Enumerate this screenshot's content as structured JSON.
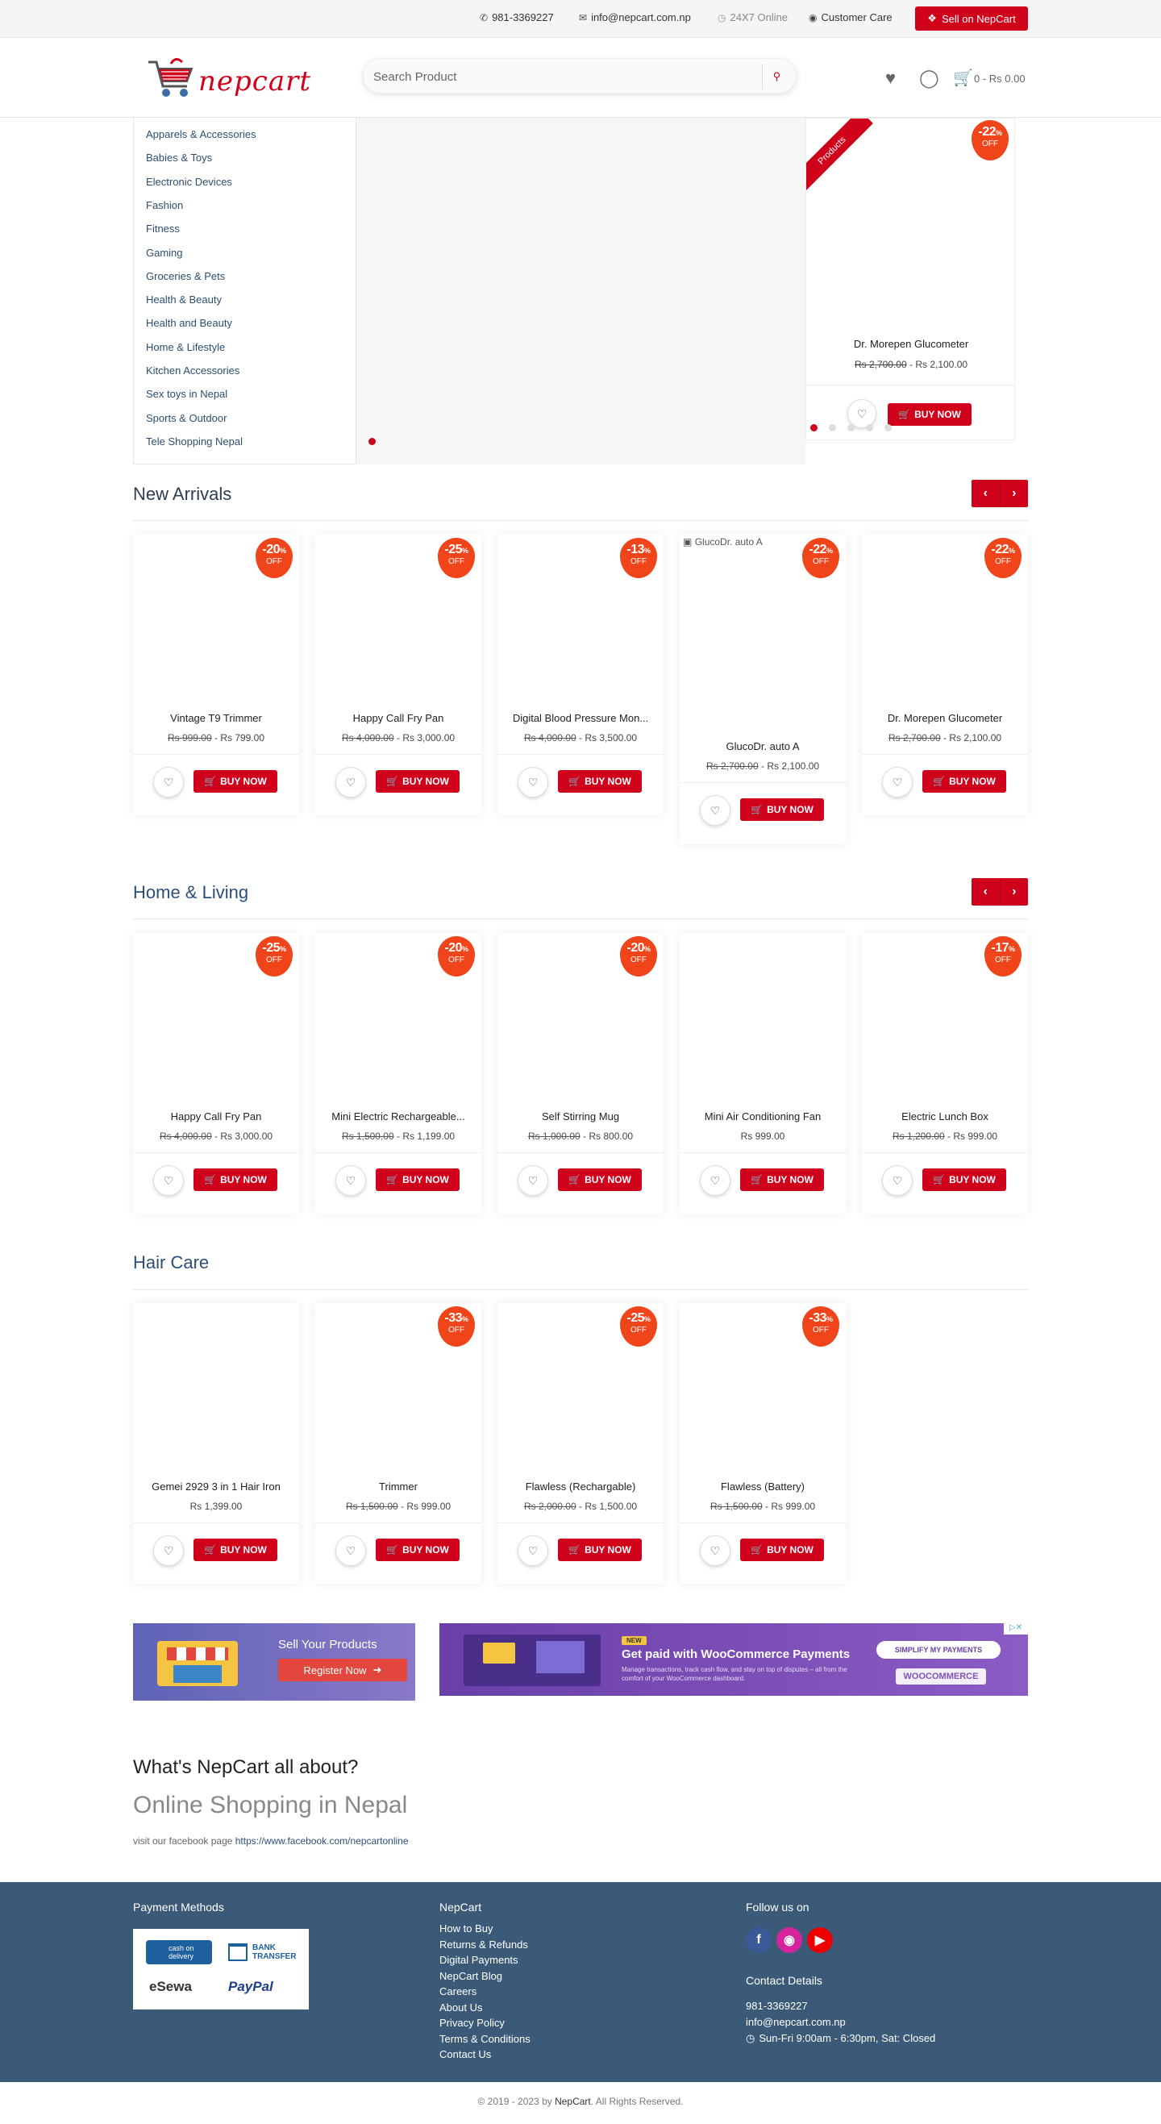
{
  "topbar": {
    "phone": "981-3369227",
    "email": "info@nepcart.com.np",
    "hours": "24X7 Online",
    "care": "Customer Care",
    "sell": "Sell on NepCart"
  },
  "header": {
    "logo_text": "nepcart",
    "search_placeholder": "Search Product",
    "cart_summary": "0 - Rs 0.00"
  },
  "categories": [
    "Apparels & Accessories",
    "Babies & Toys",
    "Electronic Devices",
    "Fashion",
    "Fitness",
    "Gaming",
    "Groceries & Pets",
    "Health & Beauty",
    "Health and Beauty",
    "Home & Lifestyle",
    "Kitchen Accessories",
    "Sex toys in Nepal",
    "Sports & Outdoor",
    "Tele Shopping Nepal"
  ],
  "featured": {
    "ribbon": "Products",
    "badge": "-22",
    "badge_off": "OFF",
    "name": "Dr. Morepen Glucometer",
    "old_price": "Rs 2,700.00",
    "price": "Rs 2,100.00",
    "buy": "BUY NOW"
  },
  "sections": {
    "new_arrivals": {
      "title": "New Arrivals",
      "products": [
        {
          "name": "Vintage T9 Trimmer",
          "old": "Rs 999.00",
          "price": "Rs 799.00",
          "badge": "-20"
        },
        {
          "name": "Happy Call Fry Pan",
          "old": "Rs 4,000.00",
          "price": "Rs 3,000.00",
          "badge": "-25"
        },
        {
          "name": "Digital Blood Pressure Mon...",
          "old": "Rs 4,000.00",
          "price": "Rs 3,500.00",
          "badge": "-13"
        },
        {
          "name": "GlucoDr. auto A",
          "old": "Rs 2,700.00",
          "price": "Rs 2,100.00",
          "badge": "-22",
          "img_alt": "GlucoDr. auto A"
        },
        {
          "name": "Dr. Morepen Glucometer",
          "old": "Rs 2,700.00",
          "price": "Rs 2,100.00",
          "badge": "-22"
        }
      ]
    },
    "home_living": {
      "title": "Home & Living",
      "products": [
        {
          "name": "Happy Call Fry Pan",
          "old": "Rs 4,000.00",
          "price": "Rs 3,000.00",
          "badge": "-25"
        },
        {
          "name": "Mini Electric Rechargeable...",
          "old": "Rs 1,500.00",
          "price": "Rs 1,199.00",
          "badge": "-20"
        },
        {
          "name": "Self Stirring Mug",
          "old": "Rs 1,000.00",
          "price": "Rs 800.00",
          "badge": "-20"
        },
        {
          "name": "Mini Air Conditioning Fan",
          "old": "",
          "price": "Rs 999.00",
          "badge": ""
        },
        {
          "name": "Electric Lunch Box",
          "old": "Rs 1,200.00",
          "price": "Rs 999.00",
          "badge": "-17"
        }
      ]
    },
    "hair_care": {
      "title": "Hair Care",
      "products": [
        {
          "name": "Gemei 2929 3 in 1 Hair Iron",
          "old": "",
          "price": "Rs 1,399.00",
          "badge": ""
        },
        {
          "name": "Trimmer",
          "old": "Rs 1,500.00",
          "price": "Rs 999.00",
          "badge": "-33"
        },
        {
          "name": "Flawless (Rechargable)",
          "old": "Rs 2,000.00",
          "price": "Rs 1,500.00",
          "badge": "-25"
        },
        {
          "name": "Flawless (Battery)",
          "old": "Rs 1,500.00",
          "price": "Rs 999.00",
          "badge": "-33"
        }
      ]
    }
  },
  "common": {
    "buy_now": "BUY NOW",
    "off": "OFF",
    "pct": "%"
  },
  "banners": {
    "sell_title": "Sell Your Products",
    "sell_btn": "Register Now",
    "woo_tag": "NEW",
    "woo_title": "Get paid with WooCommerce Payments",
    "woo_sub": "Manage transactions, track cash flow, and stay on top of disputes – all from the comfort of your WooCommerce dashboard.",
    "woo_btn": "SIMPLIFY MY PAYMENTS",
    "woo_logo": "WOOCOMMERCE"
  },
  "about": {
    "heading": "What's NepCart all about?",
    "sub": "Online Shopping in Nepal",
    "fb_text": "visit our facebook page ",
    "fb_link": "https://www.facebook.com/nepcartonline"
  },
  "footer": {
    "payment_title": "Payment Methods",
    "pay_labels": [
      "cash on delivery",
      "BANK TRANSFER",
      "eSewa",
      "PayPal"
    ],
    "nepcart_title": "NepCart",
    "links": [
      "How to Buy",
      "Returns & Refunds",
      "Digital Payments",
      "NepCart Blog",
      "Careers",
      "About Us",
      "Privacy Policy",
      "Terms & Conditions",
      "Contact Us"
    ],
    "follow_title": "Follow us on",
    "contact_title": "Contact Details",
    "contact_phone": "981-3369227",
    "contact_email": "info@nepcart.com.np",
    "contact_hours": "Sun-Fri 9:00am - 6:30pm, Sat: Closed",
    "copyright_pre": "© 2019 - 2023 by ",
    "copyright_brand": "NepCart",
    "copyright_post": ". All Rights Reserved."
  },
  "colors": {
    "accent": "#d0021b",
    "badge": "#f0441a",
    "footer": "#3b5a78"
  }
}
